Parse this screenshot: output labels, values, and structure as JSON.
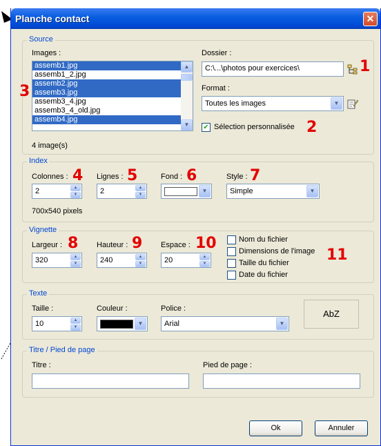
{
  "window": {
    "title": "Planche contact",
    "close_icon": "close-icon"
  },
  "source": {
    "legend": "Source",
    "images_label": "Images :",
    "images": [
      {
        "name": "assemb1.jpg",
        "selected": true
      },
      {
        "name": "assemb1_2.jpg",
        "selected": false
      },
      {
        "name": "assemb2.jpg",
        "selected": true
      },
      {
        "name": "assemb3.jpg",
        "selected": true
      },
      {
        "name": "assemb3_4.jpg",
        "selected": false
      },
      {
        "name": "assemb3_4_old.jpg",
        "selected": false
      },
      {
        "name": "assemb4.jpg",
        "selected": true
      }
    ],
    "count_text": "4 image(s)",
    "folder_label": "Dossier :",
    "folder_value": "C:\\...\\photos pour exercices\\",
    "format_label": "Format :",
    "format_value": "Toutes les images",
    "custom_selection_label": "Sélection personnalisée",
    "custom_selection_checked": true
  },
  "index": {
    "legend": "Index",
    "columns_label": "Colonnes :",
    "columns_value": "2",
    "rows_label": "Lignes :",
    "rows_value": "2",
    "background_label": "Fond :",
    "background_color": "#ffffff",
    "style_label": "Style :",
    "style_value": "Simple",
    "size_text": "700x540 pixels"
  },
  "thumbnail": {
    "legend": "Vignette",
    "width_label": "Largeur :",
    "width_value": "320",
    "height_label": "Hauteur :",
    "height_value": "240",
    "spacing_label": "Espace :",
    "spacing_value": "20",
    "options": [
      {
        "label": "Nom du fichier",
        "checked": false
      },
      {
        "label": "Dimensions de l'image",
        "checked": false
      },
      {
        "label": "Taille du fichier",
        "checked": false
      },
      {
        "label": "Date du fichier",
        "checked": false
      }
    ]
  },
  "text": {
    "legend": "Texte",
    "size_label": "Taille :",
    "size_value": "10",
    "color_label": "Couleur :",
    "color_value": "#000000",
    "font_label": "Police :",
    "font_value": "Arial",
    "preview": "AbZ"
  },
  "header_footer": {
    "legend": "Titre / Pied de page",
    "title_label": "Titre :",
    "title_value": "",
    "footer_label": "Pied de page :",
    "footer_value": ""
  },
  "buttons": {
    "ok": "Ok",
    "cancel": "Annuler"
  },
  "annotations": [
    "1",
    "2",
    "3",
    "4",
    "5",
    "6",
    "7",
    "8",
    "9",
    "10",
    "11"
  ],
  "colors": {
    "annotation": "#e30000",
    "legend": "#0046d5",
    "selection": "#316ac5"
  }
}
